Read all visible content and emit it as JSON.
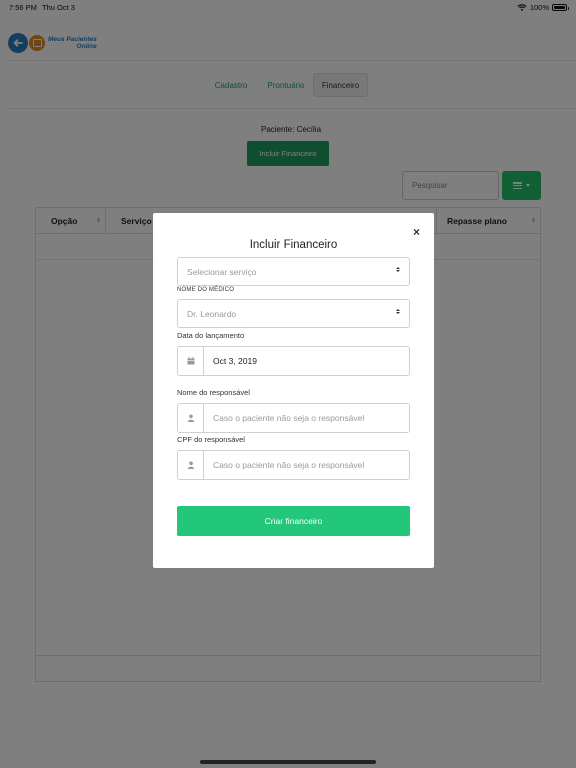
{
  "status_bar": {
    "time": "7:56 PM",
    "date": "Thu Oct 3",
    "battery": "100%",
    "battery_level": 1.0
  },
  "app": {
    "logo_line1": "Meus Pacientes",
    "logo_line2": "Online"
  },
  "tabs": [
    {
      "label": "Cadastro",
      "active": false
    },
    {
      "label": "Prontuário",
      "active": false
    },
    {
      "label": "Financeiro",
      "active": true
    }
  ],
  "page": {
    "patient_label": "Paciente: Cecília",
    "add_button": "Incluir Financeiro",
    "search_placeholder": "Pesquisar"
  },
  "table": {
    "columns": [
      "Opção",
      "Serviço",
      "Repasse plano"
    ]
  },
  "modal": {
    "title": "Incluir Financeiro",
    "close_label": "×",
    "service_select": "Selecionar serviço",
    "doctor_label": "NOME DO MÉDICO",
    "doctor_select": "Dr. Leonardo",
    "date_label": "Data do lançamento",
    "date_value": "Oct 3, 2019",
    "responsible_label": "Nome do responsável",
    "responsible_placeholder": "Caso o paciente não seja o responsável",
    "cpf_label": "CPF do responsável",
    "cpf_placeholder": "Caso o paciente não seja o responsável",
    "submit": "Criar financeiro"
  },
  "colors": {
    "primary_green": "#1e9e5e",
    "button_green": "#22c77a",
    "tab_green": "#1e9e5e",
    "overlay": "rgba(0,0,0,0.5)"
  },
  "icons": [
    "wifi-icon",
    "battery-icon",
    "logo-arrow-icon",
    "list-icon",
    "caret-down-icon",
    "calendar-icon",
    "user-icon",
    "close-icon",
    "sort-icon"
  ]
}
